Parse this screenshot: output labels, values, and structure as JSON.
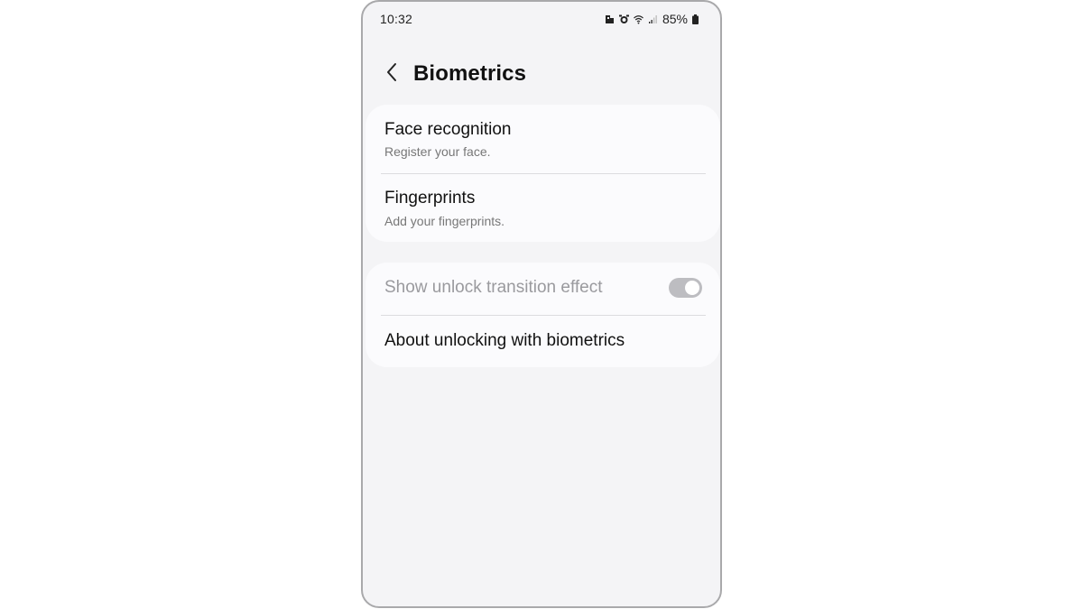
{
  "status_bar": {
    "time": "10:32",
    "battery": "85%",
    "icons": [
      "notification-icon",
      "alarm-icon",
      "wifi-icon",
      "signal-icon",
      "battery-icon"
    ]
  },
  "header": {
    "title": "Biometrics",
    "back_icon": "chevron-left-icon"
  },
  "biometrics_card": {
    "items": [
      {
        "title": "Face recognition",
        "subtitle": "Register your face."
      },
      {
        "title": "Fingerprints",
        "subtitle": "Add your fingerprints."
      }
    ]
  },
  "options_card": {
    "unlock_transition": {
      "label": "Show unlock transition effect",
      "enabled": false,
      "checked": true
    },
    "about": {
      "label": "About unlocking with biometrics"
    }
  },
  "colors": {
    "background": "#f4f4f6",
    "card": "#fbfbfd",
    "frame": "#a9a9ab",
    "disabled_text": "#9a9a9e",
    "toggle_disabled": "#bdbdc1"
  }
}
